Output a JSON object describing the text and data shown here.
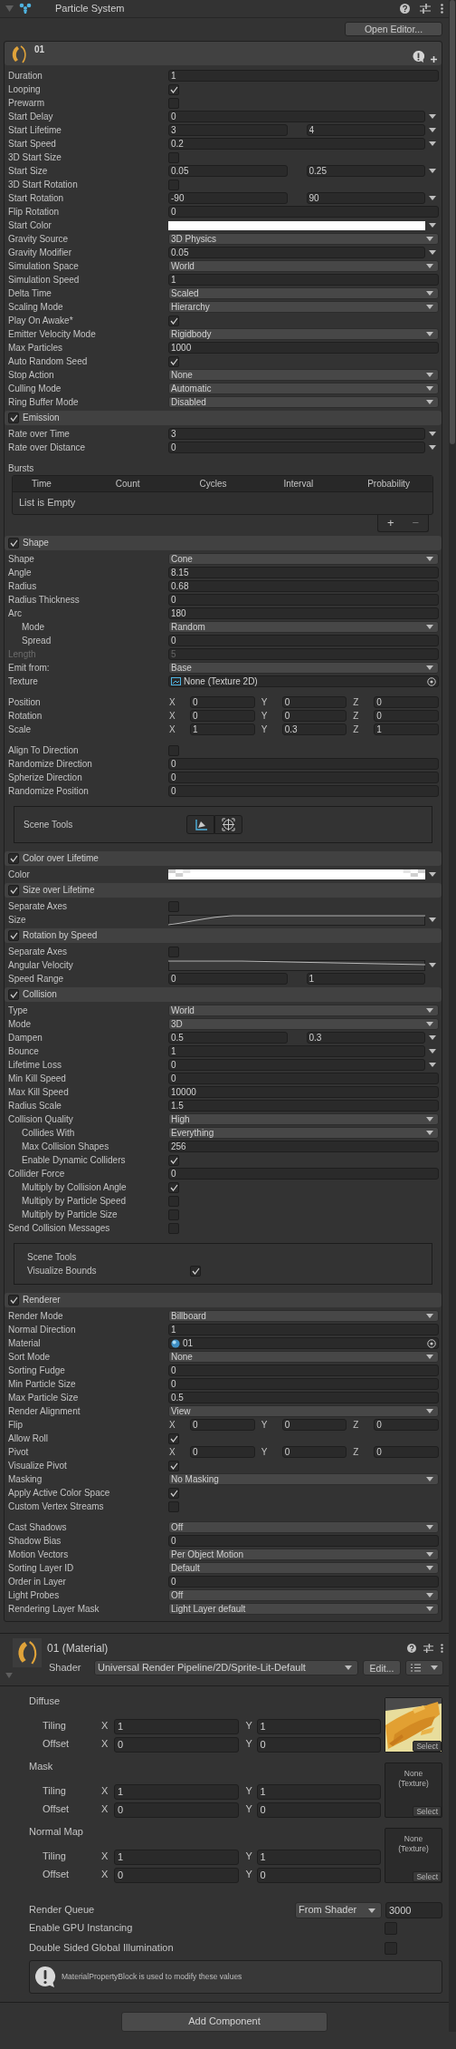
{
  "header": {
    "title": "Particle System"
  },
  "open_editor": "Open Editor...",
  "modules": [
    {
      "kind": "main",
      "title": "01",
      "rows": [
        {
          "kind": "float",
          "label": "Duration",
          "value": "1",
          "menu": false
        },
        {
          "kind": "check",
          "label": "Looping",
          "checked": true
        },
        {
          "kind": "check",
          "label": "Prewarm",
          "checked": false
        },
        {
          "kind": "float",
          "label": "Start Delay",
          "value": "0",
          "menu": true
        },
        {
          "kind": "range",
          "label": "Start Lifetime",
          "values": [
            "3",
            "4"
          ],
          "menu": true
        },
        {
          "kind": "float",
          "label": "Start Speed",
          "value": "0.2",
          "menu": true
        },
        {
          "kind": "check",
          "label": "3D Start Size",
          "checked": false
        },
        {
          "kind": "range",
          "label": "Start Size",
          "values": [
            "0.05",
            "0.25"
          ],
          "menu": true
        },
        {
          "kind": "check",
          "label": "3D Start Rotation",
          "checked": false
        },
        {
          "kind": "range",
          "label": "Start Rotation",
          "values": [
            "-90",
            "90"
          ],
          "menu": true
        },
        {
          "kind": "float",
          "label": "Flip Rotation",
          "value": "0",
          "menu": false
        },
        {
          "kind": "color",
          "label": "Start Color",
          "color": "#ffffff",
          "menu": true
        },
        {
          "kind": "dropdown",
          "label": "Gravity Source",
          "value": "3D Physics"
        },
        {
          "kind": "float",
          "label": "Gravity Modifier",
          "value": "0.05",
          "menu": true
        },
        {
          "kind": "dropdown",
          "label": "Simulation Space",
          "value": "World"
        },
        {
          "kind": "float",
          "label": "Simulation Speed",
          "value": "1",
          "menu": false
        },
        {
          "kind": "dropdown",
          "label": "Delta Time",
          "value": "Scaled"
        },
        {
          "kind": "dropdown",
          "label": "Scaling Mode",
          "value": "Hierarchy"
        },
        {
          "kind": "check",
          "label": "Play On Awake*",
          "checked": true
        },
        {
          "kind": "dropdown",
          "label": "Emitter Velocity Mode",
          "value": "Rigidbody"
        },
        {
          "kind": "float",
          "label": "Max Particles",
          "value": "1000",
          "menu": false
        },
        {
          "kind": "check",
          "label": "Auto Random Seed",
          "checked": true
        },
        {
          "kind": "dropdown",
          "label": "Stop Action",
          "value": "None"
        },
        {
          "kind": "dropdown",
          "label": "Culling Mode",
          "value": "Automatic"
        },
        {
          "kind": "dropdown",
          "label": "Ring Buffer Mode",
          "value": "Disabled"
        }
      ]
    },
    {
      "kind": "module",
      "title": "Emission",
      "enabled": true,
      "rows": [
        {
          "kind": "float",
          "label": "Rate over Time",
          "value": "3",
          "menu": true
        },
        {
          "kind": "float",
          "label": "Rate over Distance",
          "value": "0",
          "menu": true
        },
        {
          "kind": "bursts",
          "label": "Bursts",
          "columns": [
            "Time",
            "Count",
            "Cycles",
            "Interval",
            "Probability"
          ],
          "empty_text": "List is Empty",
          "add": "+",
          "remove": "−"
        }
      ]
    },
    {
      "kind": "module",
      "title": "Shape",
      "enabled": true,
      "rows": [
        {
          "kind": "dropdown",
          "label": "Shape",
          "value": "Cone"
        },
        {
          "kind": "float",
          "label": "Angle",
          "value": "8.15",
          "menu": false
        },
        {
          "kind": "float",
          "label": "Radius",
          "value": "0.68",
          "menu": false
        },
        {
          "kind": "float",
          "label": "Radius Thickness",
          "value": "0",
          "menu": false
        },
        {
          "kind": "float",
          "label": "Arc",
          "value": "180",
          "menu": false
        },
        {
          "kind": "dropdown",
          "label": "Mode",
          "value": "Random",
          "indent": true
        },
        {
          "kind": "float",
          "label": "Spread",
          "value": "0",
          "menu": false,
          "indent": true
        },
        {
          "kind": "float",
          "label": "Length",
          "value": "5",
          "menu": false,
          "disabled": true
        },
        {
          "kind": "dropdown",
          "label": "Emit from:",
          "value": "Base"
        },
        {
          "kind": "texture_slot",
          "label": "Texture",
          "value": "None (Texture 2D)"
        },
        {
          "kind": "gap"
        },
        {
          "kind": "xyz",
          "label": "Position",
          "axes": [
            "X",
            "Y",
            "Z"
          ],
          "values": [
            "0",
            "0",
            "0"
          ]
        },
        {
          "kind": "xyz",
          "label": "Rotation",
          "axes": [
            "X",
            "Y",
            "Z"
          ],
          "values": [
            "0",
            "0",
            "0"
          ]
        },
        {
          "kind": "xyz",
          "label": "Scale",
          "axes": [
            "X",
            "Y",
            "Z"
          ],
          "values": [
            "1",
            "0.3",
            "1"
          ]
        },
        {
          "kind": "gap"
        },
        {
          "kind": "check",
          "label": "Align To Direction",
          "checked": false
        },
        {
          "kind": "float",
          "label": "Randomize Direction",
          "value": "0",
          "menu": false
        },
        {
          "kind": "float",
          "label": "Spherize Direction",
          "value": "0",
          "menu": false
        },
        {
          "kind": "float",
          "label": "Randomize Position",
          "value": "0",
          "menu": false
        },
        {
          "kind": "scene_tools_buttons",
          "label": "Scene Tools"
        }
      ]
    },
    {
      "kind": "module",
      "title": "Color over Lifetime",
      "enabled": true,
      "rows": [
        {
          "kind": "gradient",
          "label": "Color",
          "menu": true
        }
      ]
    },
    {
      "kind": "module",
      "title": "Size over Lifetime",
      "enabled": true,
      "rows": [
        {
          "kind": "check",
          "label": "Separate Axes",
          "checked": false
        },
        {
          "kind": "rising_curve",
          "label": "Size",
          "menu": true
        }
      ]
    },
    {
      "kind": "module",
      "title": "Rotation by Speed",
      "enabled": true,
      "rows": [
        {
          "kind": "check",
          "label": "Separate Axes",
          "checked": false
        },
        {
          "kind": "falling_curve",
          "label": "Angular Velocity",
          "menu": true
        },
        {
          "kind": "range",
          "label": "Speed Range",
          "values": [
            "0",
            "1"
          ],
          "menu": false
        }
      ]
    },
    {
      "kind": "module",
      "title": "Collision",
      "enabled": true,
      "rows": [
        {
          "kind": "dropdown",
          "label": "Type",
          "value": "World"
        },
        {
          "kind": "dropdown",
          "label": "Mode",
          "value": "3D"
        },
        {
          "kind": "range",
          "label": "Dampen",
          "values": [
            "0.5",
            "0.3"
          ],
          "menu": true
        },
        {
          "kind": "float",
          "label": "Bounce",
          "value": "1",
          "menu": true
        },
        {
          "kind": "float",
          "label": "Lifetime Loss",
          "value": "0",
          "menu": true
        },
        {
          "kind": "float",
          "label": "Min Kill Speed",
          "value": "0",
          "menu": false
        },
        {
          "kind": "float",
          "label": "Max Kill Speed",
          "value": "10000",
          "menu": false
        },
        {
          "kind": "float",
          "label": "Radius Scale",
          "value": "1.5",
          "menu": false
        },
        {
          "kind": "dropdown",
          "label": "Collision Quality",
          "value": "High"
        },
        {
          "kind": "dropdown",
          "label": "Collides With",
          "value": "Everything",
          "indent": true
        },
        {
          "kind": "float",
          "label": "Max Collision Shapes",
          "value": "256",
          "menu": false,
          "indent": true
        },
        {
          "kind": "check",
          "label": "Enable Dynamic Colliders",
          "checked": true,
          "indent": true
        },
        {
          "kind": "float",
          "label": "Collider Force",
          "value": "0",
          "menu": false
        },
        {
          "kind": "check",
          "label": "Multiply by Collision Angle",
          "checked": true,
          "indent": true
        },
        {
          "kind": "check",
          "label": "Multiply by Particle Speed",
          "checked": false,
          "indent": true
        },
        {
          "kind": "check",
          "label": "Multiply by Particle Size",
          "checked": false,
          "indent": true
        },
        {
          "kind": "check",
          "label": "Send Collision Messages",
          "checked": false
        },
        {
          "kind": "scene_tools_check",
          "label": "Scene Tools",
          "check_label": "Visualize Bounds",
          "checked": true
        }
      ]
    },
    {
      "kind": "module",
      "title": "Renderer",
      "enabled": true,
      "rows": [
        {
          "kind": "dropdown",
          "label": "Render Mode",
          "value": "Billboard"
        },
        {
          "kind": "float",
          "label": "Normal Direction",
          "value": "1",
          "menu": false
        },
        {
          "kind": "material_slot",
          "label": "Material",
          "value": "01"
        },
        {
          "kind": "dropdown",
          "label": "Sort Mode",
          "value": "None"
        },
        {
          "kind": "float",
          "label": "Sorting Fudge",
          "value": "0",
          "menu": false
        },
        {
          "kind": "float",
          "label": "Min Particle Size",
          "value": "0",
          "menu": false
        },
        {
          "kind": "float",
          "label": "Max Particle Size",
          "value": "0.5",
          "menu": false
        },
        {
          "kind": "dropdown",
          "label": "Render Alignment",
          "value": "View"
        },
        {
          "kind": "xyz",
          "label": "Flip",
          "axes": [
            "X",
            "Y",
            "Z"
          ],
          "values": [
            "0",
            "0",
            "0"
          ]
        },
        {
          "kind": "check",
          "label": "Allow Roll",
          "checked": true
        },
        {
          "kind": "xyz",
          "label": "Pivot",
          "axes": [
            "X",
            "Y",
            "Z"
          ],
          "values": [
            "0",
            "0",
            "0"
          ]
        },
        {
          "kind": "check",
          "label": "Visualize Pivot",
          "checked": true
        },
        {
          "kind": "dropdown",
          "label": "Masking",
          "value": "No Masking"
        },
        {
          "kind": "check",
          "label": "Apply Active Color Space",
          "checked": true
        },
        {
          "kind": "check",
          "label": "Custom Vertex Streams",
          "checked": false
        },
        {
          "kind": "gap"
        },
        {
          "kind": "dropdown",
          "label": "Cast Shadows",
          "value": "Off"
        },
        {
          "kind": "float",
          "label": "Shadow Bias",
          "value": "0",
          "menu": false
        },
        {
          "kind": "dropdown",
          "label": "Motion Vectors",
          "value": "Per Object Motion"
        },
        {
          "kind": "dropdown",
          "label": "Sorting Layer ID",
          "value": "Default"
        },
        {
          "kind": "float",
          "label": "Order in Layer",
          "value": "0",
          "menu": false
        },
        {
          "kind": "dropdown",
          "label": "Light Probes",
          "value": "Off"
        },
        {
          "kind": "dropdown",
          "label": "Rendering Layer Mask",
          "value": "Light Layer default"
        }
      ]
    }
  ],
  "material": {
    "title": "01 (Material)",
    "shader_label": "Shader",
    "shader": "Universal Render Pipeline/2D/Sprite-Lit-Default",
    "edit": "Edit...",
    "textures": [
      {
        "name": "Diffuse",
        "slot": {
          "kind": "picture"
        },
        "select": "Select",
        "rows": [
          {
            "label": "Tiling",
            "axes": [
              "X",
              "Y"
            ],
            "values": [
              "1",
              "1"
            ]
          },
          {
            "label": "Offset",
            "axes": [
              "X",
              "Y"
            ],
            "values": [
              "0",
              "0"
            ]
          }
        ]
      },
      {
        "name": "Mask",
        "slot": {
          "kind": "empty",
          "text": "None (Texture)"
        },
        "select": "Select",
        "rows": [
          {
            "label": "Tiling",
            "axes": [
              "X",
              "Y"
            ],
            "values": [
              "1",
              "1"
            ]
          },
          {
            "label": "Offset",
            "axes": [
              "X",
              "Y"
            ],
            "values": [
              "0",
              "0"
            ]
          }
        ]
      },
      {
        "name": "Normal Map",
        "slot": {
          "kind": "empty",
          "text": "None (Texture)"
        },
        "select": "Select",
        "rows": [
          {
            "label": "Tiling",
            "axes": [
              "X",
              "Y"
            ],
            "values": [
              "1",
              "1"
            ]
          },
          {
            "label": "Offset",
            "axes": [
              "X",
              "Y"
            ],
            "values": [
              "0",
              "0"
            ]
          }
        ]
      }
    ],
    "render_queue": {
      "label": "Render Queue",
      "mode": "From Shader",
      "value": "3000"
    },
    "checks": [
      {
        "label": "Enable GPU Instancing",
        "checked": false
      },
      {
        "label": "Double Sided Global Illumination",
        "checked": false
      }
    ],
    "info": "MaterialPropertyBlock is used to modify these values"
  },
  "add_component": "Add Component"
}
